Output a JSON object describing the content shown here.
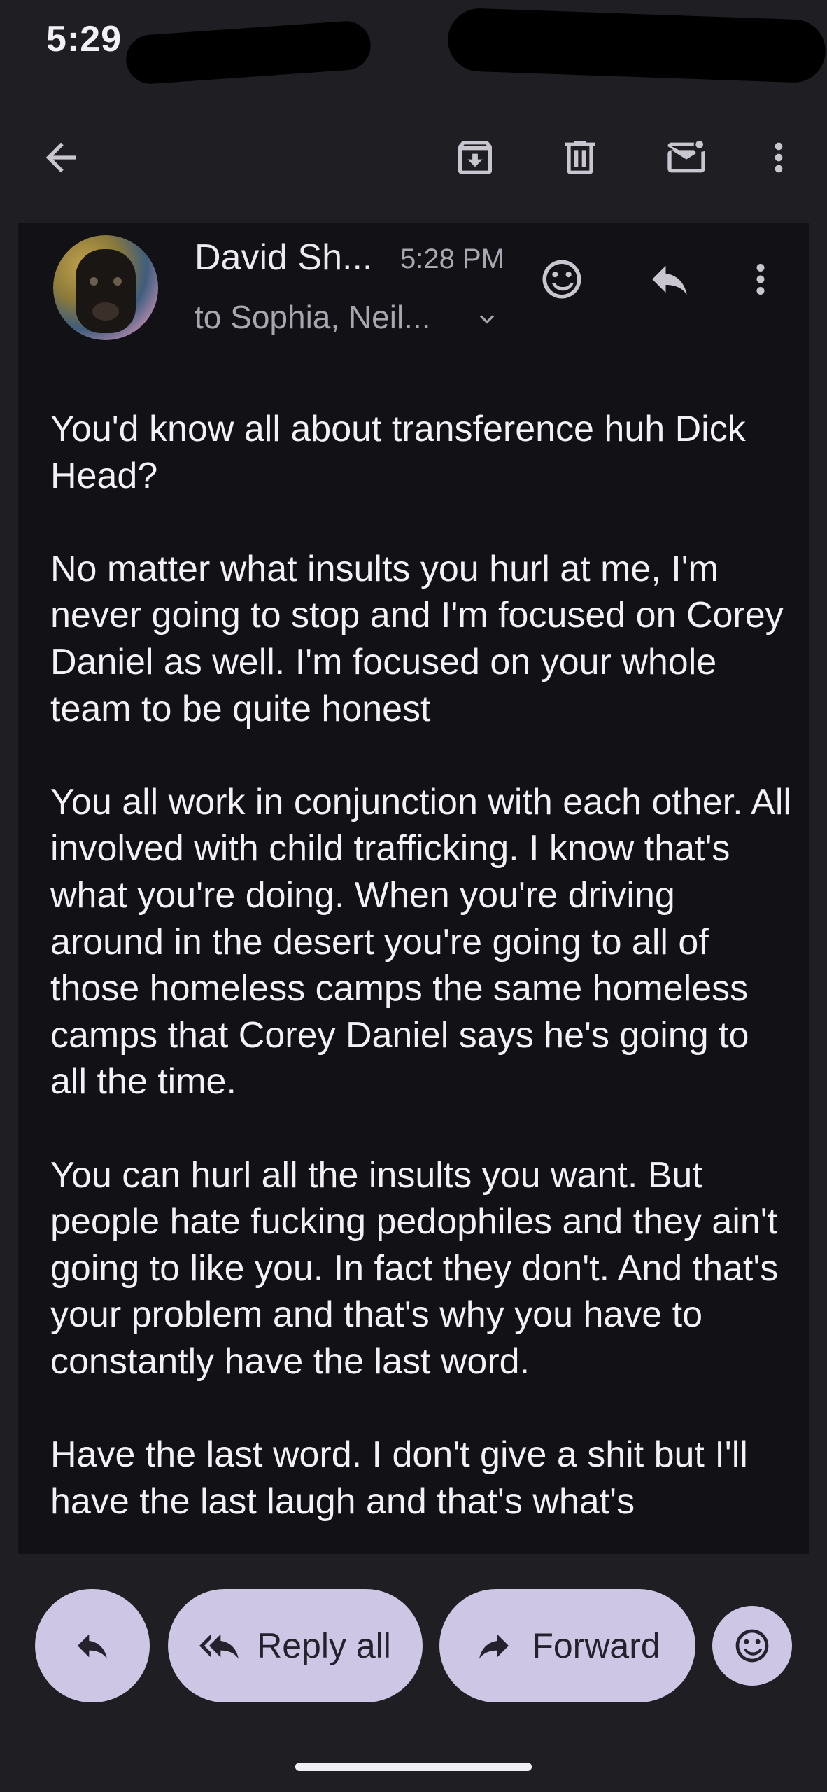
{
  "status_bar": {
    "time": "5:29"
  },
  "toolbar": {
    "back": "arrow-back-icon",
    "archive": "archive-icon",
    "delete": "trash-icon",
    "mark_unread": "mail-unread-icon",
    "more": "more-vert-icon"
  },
  "message": {
    "sender": "David Sh...",
    "time": "5:28 PM",
    "recipients": "to Sophia, Neil...",
    "paragraphs": [
      "You'd know all about transference huh Dick Head?",
      "No matter what insults you hurl at me, I'm never going to stop and I'm focused on Corey Daniel as well. I'm focused on your whole team to be quite honest",
      "You all work in conjunction with each other. All involved with child trafficking. I know that's what you're doing. When you're driving around in the desert you're going to all of those homeless camps the same homeless camps that Corey Daniel says he's going to all the time.",
      "You can hurl all the insults you want. But people hate fucking pedophiles and they ain't going to like you. In fact they don't. And that's your problem and that's why you have to constantly have the last word.",
      "Have the last word. I don't give a shit but I'll have the last laugh and that's what's"
    ]
  },
  "actions": {
    "reply_label": "",
    "reply_all_label": "Reply all",
    "forward_label": "Forward"
  }
}
